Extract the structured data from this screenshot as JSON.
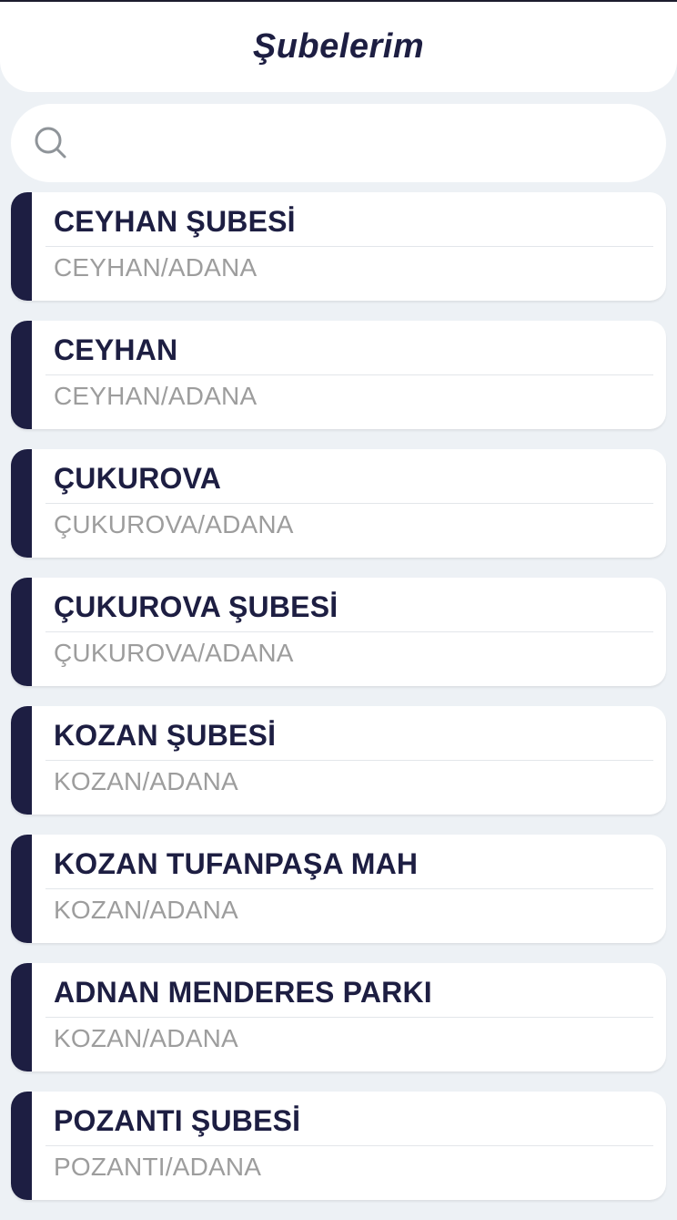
{
  "header": {
    "title": "Şubelerim"
  },
  "search": {
    "placeholder": "",
    "value": ""
  },
  "branches": [
    {
      "name": "CEYHAN ŞUBESİ",
      "location": "CEYHAN/ADANA"
    },
    {
      "name": "CEYHAN",
      "location": "CEYHAN/ADANA"
    },
    {
      "name": "ÇUKUROVA",
      "location": "ÇUKUROVA/ADANA"
    },
    {
      "name": "ÇUKUROVA ŞUBESİ",
      "location": "ÇUKUROVA/ADANA"
    },
    {
      "name": "KOZAN ŞUBESİ",
      "location": "KOZAN/ADANA"
    },
    {
      "name": "KOZAN TUFANPAŞA MAH",
      "location": "KOZAN/ADANA"
    },
    {
      "name": "ADNAN MENDERES PARKI",
      "location": "KOZAN/ADANA"
    },
    {
      "name": "POZANTI ŞUBESİ",
      "location": "POZANTI/ADANA"
    }
  ],
  "colors": {
    "accent": "#1d1e42",
    "background": "#edf1f5",
    "secondary_text": "#9d9d9d"
  }
}
